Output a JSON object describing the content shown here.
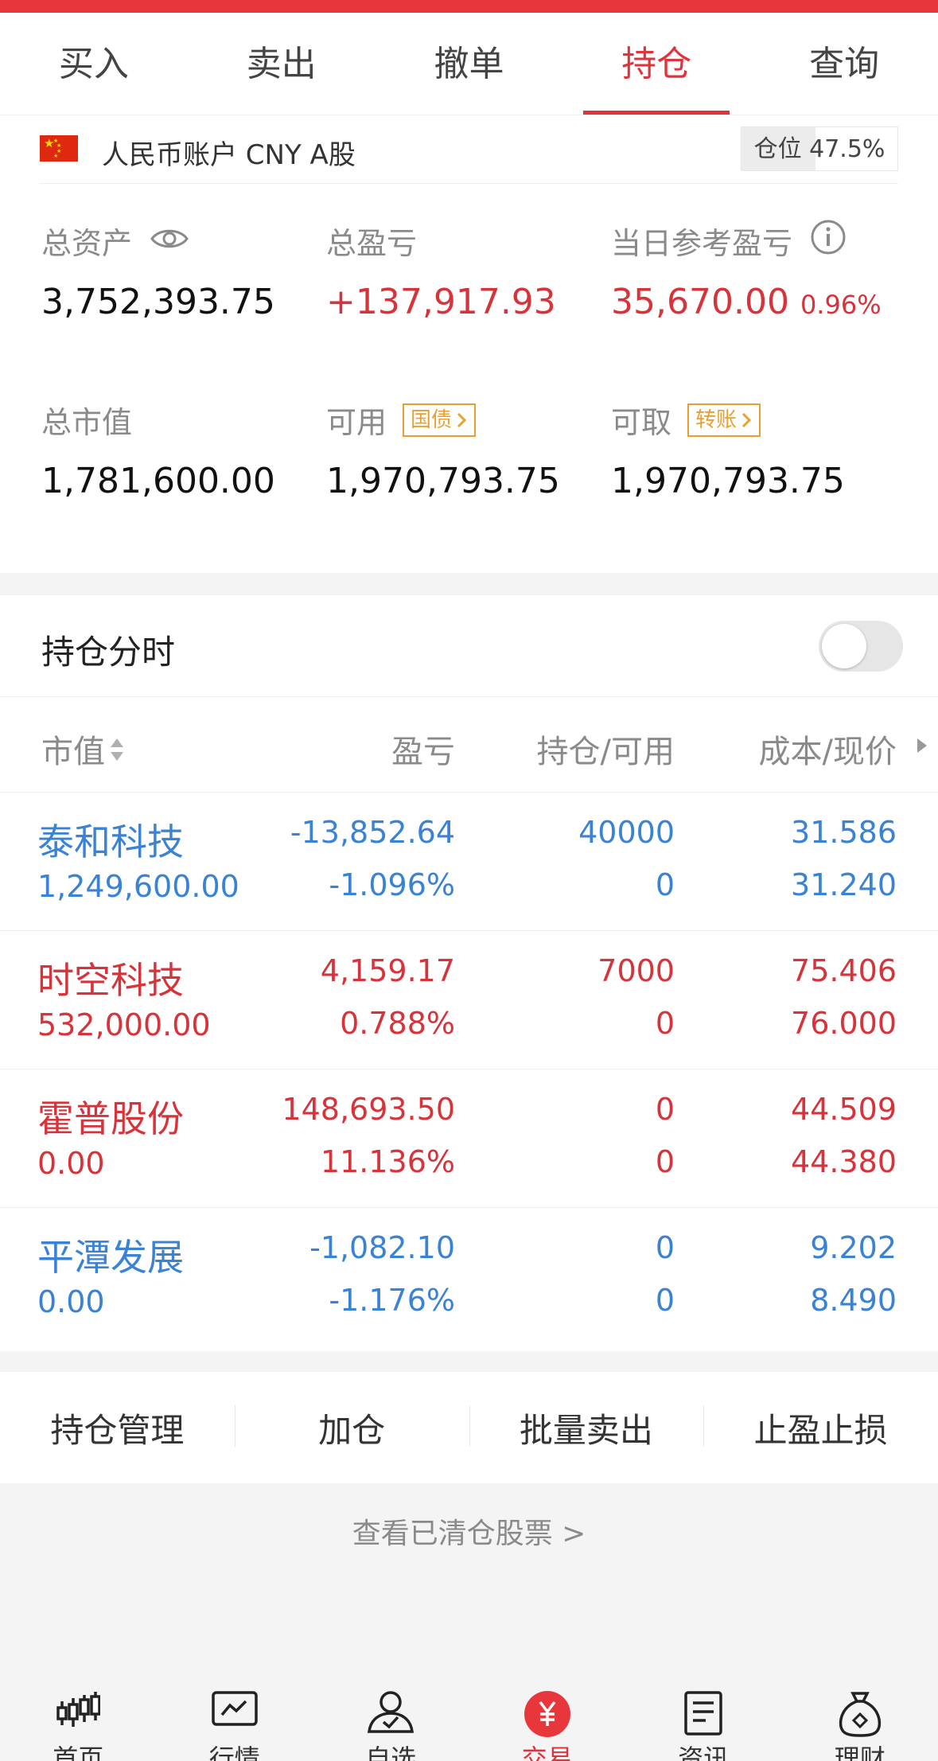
{
  "tabs": [
    {
      "label": "买入"
    },
    {
      "label": "卖出"
    },
    {
      "label": "撤单"
    },
    {
      "label": "持仓"
    },
    {
      "label": "查询"
    }
  ],
  "active_tab": "持仓",
  "account": {
    "name": "人民币账户 CNY A股",
    "position_label": "仓位 47.5%",
    "position_ratio": 0.475
  },
  "stats": {
    "total_assets": {
      "label": "总资产",
      "value": "3,752,393.75"
    },
    "total_pnl": {
      "label": "总盈亏",
      "value": "+137,917.93"
    },
    "daily_pnl": {
      "label": "当日参考盈亏",
      "value": "35,670.00",
      "percent": "0.96%"
    },
    "market_value": {
      "label": "总市值",
      "value": "1,781,600.00"
    },
    "available": {
      "label": "可用",
      "tag": "国债",
      "value": "1,970,793.75"
    },
    "withdrawable": {
      "label": "可取",
      "tag": "转账",
      "value": "1,970,793.75"
    }
  },
  "holdings": {
    "title": "持仓分时",
    "toggle_on": false,
    "columns": [
      "市值",
      "盈亏",
      "持仓/可用",
      "成本/现价"
    ],
    "rows": [
      {
        "name": "泰和科技",
        "market_value": "1,249,600.00",
        "pnl": "-13,852.64",
        "pnl_pct": "-1.096%",
        "holding": "40000",
        "available": "0",
        "cost": "31.586",
        "price": "31.240",
        "trend": "down"
      },
      {
        "name": "时空科技",
        "market_value": "532,000.00",
        "pnl": "4,159.17",
        "pnl_pct": "0.788%",
        "holding": "7000",
        "available": "0",
        "cost": "75.406",
        "price": "76.000",
        "trend": "up"
      },
      {
        "name": "霍普股份",
        "market_value": "0.00",
        "pnl": "148,693.50",
        "pnl_pct": "11.136%",
        "holding": "0",
        "available": "0",
        "cost": "44.509",
        "price": "44.380",
        "trend": "up"
      },
      {
        "name": "平潭发展",
        "market_value": "0.00",
        "pnl": "-1,082.10",
        "pnl_pct": "-1.176%",
        "holding": "0",
        "available": "0",
        "cost": "9.202",
        "price": "8.490",
        "trend": "down"
      }
    ]
  },
  "actions": [
    {
      "label": "持仓管理"
    },
    {
      "label": "加仓"
    },
    {
      "label": "批量卖出"
    },
    {
      "label": "止盈止损"
    }
  ],
  "cleared_link": "查看已清仓股票 >",
  "bottom_nav": [
    {
      "label": "首页",
      "icon": "candlestick-icon"
    },
    {
      "label": "行情",
      "icon": "chart-icon"
    },
    {
      "label": "自选",
      "icon": "user-check-icon"
    },
    {
      "label": "交易",
      "icon": "yuan-icon"
    },
    {
      "label": "资讯",
      "icon": "document-icon"
    },
    {
      "label": "理财",
      "icon": "money-bag-icon"
    }
  ],
  "colors": {
    "accent": "#e0343c",
    "up": "#d6333a",
    "down": "#3a82d4",
    "tag": "#e9a030"
  }
}
